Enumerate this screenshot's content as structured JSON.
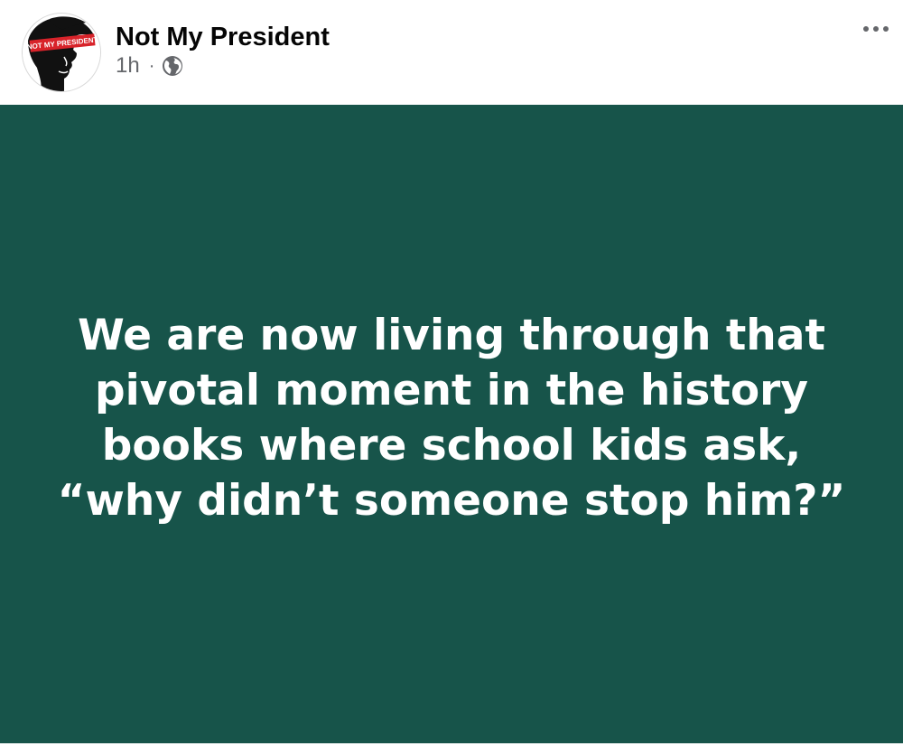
{
  "post": {
    "author": "Not My President",
    "timestamp": "1h",
    "separator": "·",
    "audience_icon": "globe-icon",
    "menu_icon": "more-horizontal-icon",
    "avatar": {
      "icon": "protest-avatar-icon",
      "banner_text": "NOT MY PRESIDENT"
    },
    "body_text": "We are now living through that pivotal moment in the history books where school kids ask, “why didn’t someone stop him?”",
    "background_color": "#17544a",
    "text_color": "#ffffff"
  }
}
